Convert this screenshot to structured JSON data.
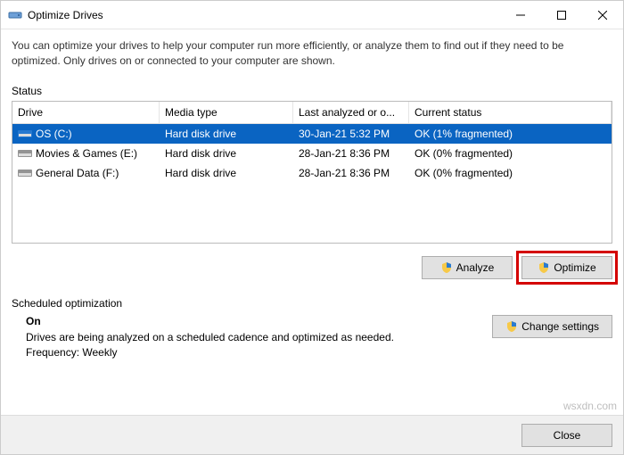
{
  "window": {
    "title": "Optimize Drives",
    "description": "You can optimize your drives to help your computer run more efficiently, or analyze them to find out if they need to be optimized. Only drives on or connected to your computer are shown."
  },
  "status": {
    "label": "Status",
    "columns": {
      "drive": "Drive",
      "media": "Media type",
      "last": "Last analyzed or o...",
      "status": "Current status"
    },
    "rows": [
      {
        "drive": "OS (C:)",
        "media": "Hard disk drive",
        "last": "30-Jan-21 5:32 PM",
        "status": "OK (1% fragmented)",
        "selected": true,
        "iconColor": "#2a7bd1"
      },
      {
        "drive": "Movies & Games (E:)",
        "media": "Hard disk drive",
        "last": "28-Jan-21 8:36 PM",
        "status": "OK (0% fragmented)",
        "selected": false,
        "iconColor": "#888"
      },
      {
        "drive": "General Data (F:)",
        "media": "Hard disk drive",
        "last": "28-Jan-21 8:36 PM",
        "status": "OK (0% fragmented)",
        "selected": false,
        "iconColor": "#888"
      }
    ]
  },
  "buttons": {
    "analyze": "Analyze",
    "optimize": "Optimize",
    "changeSettings": "Change settings",
    "close": "Close"
  },
  "scheduled": {
    "label": "Scheduled optimization",
    "state": "On",
    "desc": "Drives are being analyzed on a scheduled cadence and optimized as needed.",
    "freq": "Frequency: Weekly"
  },
  "watermark": "wsxdn.com"
}
